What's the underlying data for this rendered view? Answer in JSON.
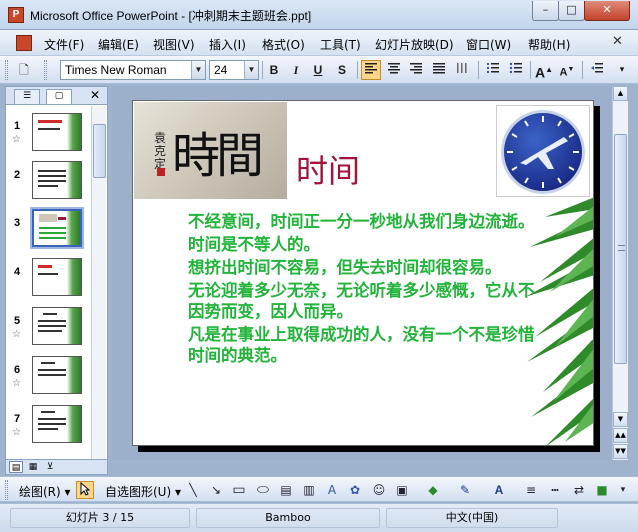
{
  "window": {
    "title": "Microsoft Office PowerPoint - [冲刺期末主题班会.ppt]",
    "app_icon": "powerpoint-icon",
    "minimize_glyph": "–",
    "maximize_glyph": "□",
    "close_glyph": "✕"
  },
  "menu": {
    "items": [
      "文件(F)",
      "编辑(E)",
      "视图(V)",
      "插入(I)",
      "格式(O)",
      "工具(T)",
      "幻灯片放映(D)",
      "窗口(W)",
      "帮助(H)"
    ],
    "close_glyph": "✕"
  },
  "format_toolbar": {
    "font_name": "Times New Roman",
    "font_size": "24",
    "bold": "B",
    "italic": "I",
    "underline": "U",
    "shadow": "S",
    "grow_font": "A",
    "shrink_font": "A",
    "align_active": "left"
  },
  "left_panel": {
    "tabs": [
      "outline-tab",
      "slides-tab"
    ],
    "close_glyph": "✕",
    "selected_slide": 3,
    "slides": [
      {
        "num": "1",
        "star": "☆"
      },
      {
        "num": "2",
        "star": ""
      },
      {
        "num": "3",
        "star": ""
      },
      {
        "num": "4",
        "star": ""
      },
      {
        "num": "5",
        "star": "☆"
      },
      {
        "num": "6",
        "star": "☆"
      },
      {
        "num": "7",
        "star": "☆"
      }
    ]
  },
  "slide": {
    "title": "时间",
    "calligraphy_text": "時間",
    "calligraphy_side": "袁克定",
    "title_color": "#a0143a",
    "text_color": "#22b33a",
    "paragraphs": [
      "不经意间，时间正一分一秒地从我们身边流逝。",
      "时间是不等人的。",
      "想挤出时间不容易，但失去时间却很容易。",
      "无论迎着多少无奈，无论听着多少感慨，它从不因势而变，因人而异。",
      "凡是在事业上取得成功的人，没有一个不是珍惜时间的典范。"
    ]
  },
  "draw_toolbar": {
    "draw_label": "绘图(R)",
    "autoshape_label": "自选图形(U)"
  },
  "status": {
    "slide_indicator": "幻灯片 3 / 15",
    "design": "Bamboo",
    "language": "中文(中国)"
  }
}
